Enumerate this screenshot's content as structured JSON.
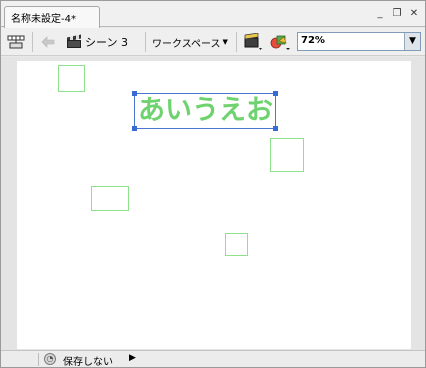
{
  "document_tab": {
    "title": "名称未設定-4*"
  },
  "window_controls": {
    "minimize": "_",
    "restore": "❐",
    "close": "✕"
  },
  "toolbar": {
    "scene_label": "シーン 3",
    "workspace_label": "ワークスペース",
    "zoom_value": "72%"
  },
  "stage": {
    "text_content": "あいうえお",
    "text_color": "#6ed36e",
    "box_color": "#8ee28e"
  },
  "status": {
    "label": "保存しない"
  }
}
